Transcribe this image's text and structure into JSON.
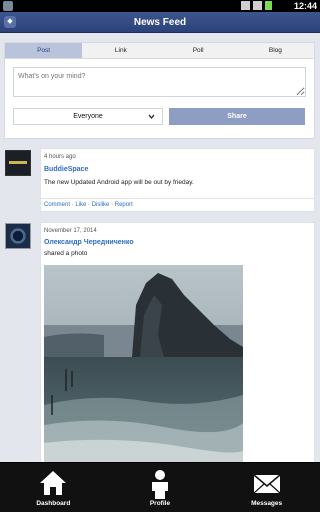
{
  "status_bar": {
    "time": "12:44"
  },
  "header": {
    "title": "News Feed"
  },
  "composer": {
    "tabs": [
      {
        "label": "Post"
      },
      {
        "label": "Link"
      },
      {
        "label": "Poll"
      },
      {
        "label": "Blog"
      }
    ],
    "active_tab": "Post",
    "placeholder": "What's on your mind?",
    "audience": "Everyone",
    "share_label": "Share"
  },
  "posts": [
    {
      "time": "4 hours ago",
      "author": "BuddieSpace",
      "text": "The new Updated Android app will be out by frieday.",
      "actions": {
        "comment": "Comment",
        "like": "Like",
        "dislike": "Dislike",
        "report": "Report"
      }
    },
    {
      "time": "November 17, 2014",
      "author": "Олександр Чередниченко",
      "text": "shared a photo"
    }
  ],
  "bottom_nav": [
    {
      "label": "Dashboard",
      "icon": "home-icon"
    },
    {
      "label": "Profile",
      "icon": "person-icon"
    },
    {
      "label": "Messages",
      "icon": "envelope-icon"
    }
  ],
  "colors": {
    "header": "#2c4279",
    "link": "#2f6cc0",
    "share": "#8e9dc2",
    "background": "#e4e6ee"
  }
}
